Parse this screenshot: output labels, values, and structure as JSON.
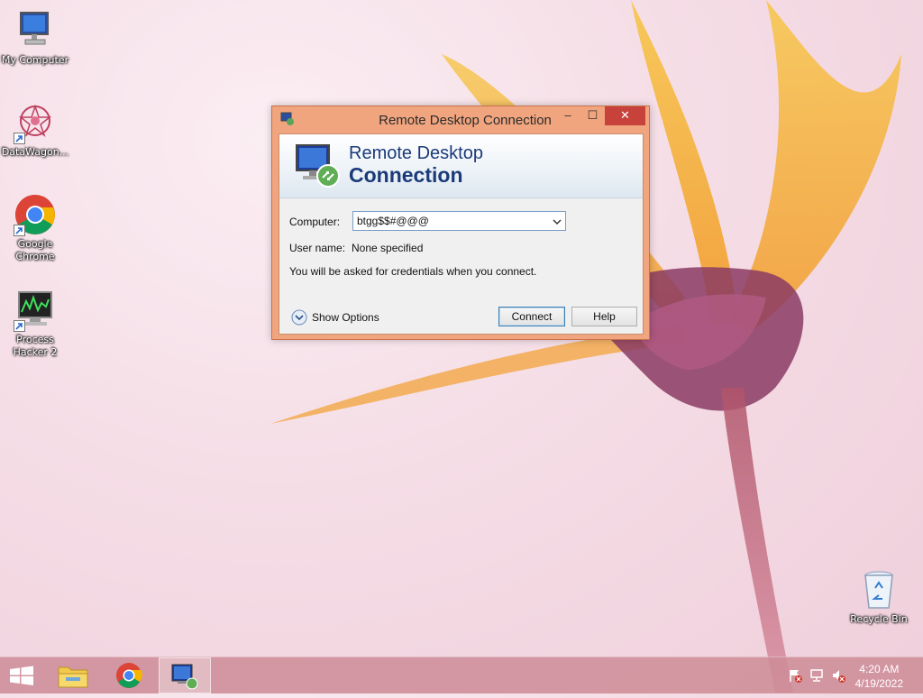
{
  "desktop": {
    "icons": [
      {
        "label": "My Computer"
      },
      {
        "label": "DataWagon..."
      },
      {
        "label": "Google Chrome"
      },
      {
        "label": "Process Hacker 2"
      },
      {
        "label": "Recycle Bin"
      }
    ]
  },
  "dialog": {
    "title": "Remote Desktop Connection",
    "window_buttons": {
      "minimize": "–",
      "maximize": "☐",
      "close": "✕"
    },
    "banner_line1": "Remote Desktop",
    "banner_line2": "Connection",
    "computer_label": "Computer:",
    "computer_value": "btgg$$#@@@",
    "username_label": "User name:",
    "username_value": "None specified",
    "credentials_note": "You will be asked for credentials when you connect.",
    "show_options_label": "Show Options",
    "connect_label": "Connect",
    "help_label": "Help"
  },
  "taskbar": {
    "items": [
      "start-icon",
      "file-explorer-icon",
      "chrome-icon",
      "remote-desktop-icon"
    ],
    "active_item": "remote-desktop-icon",
    "tray_icons": [
      "action-center-flag-icon",
      "network-icon",
      "volume-muted-icon"
    ],
    "clock_time": "4:20 AM",
    "clock_date": "4/19/2022"
  },
  "colors": {
    "dialog_frame": "#f0a57f",
    "close_button": "#c7423a",
    "banner_text": "#1a3a7a"
  }
}
